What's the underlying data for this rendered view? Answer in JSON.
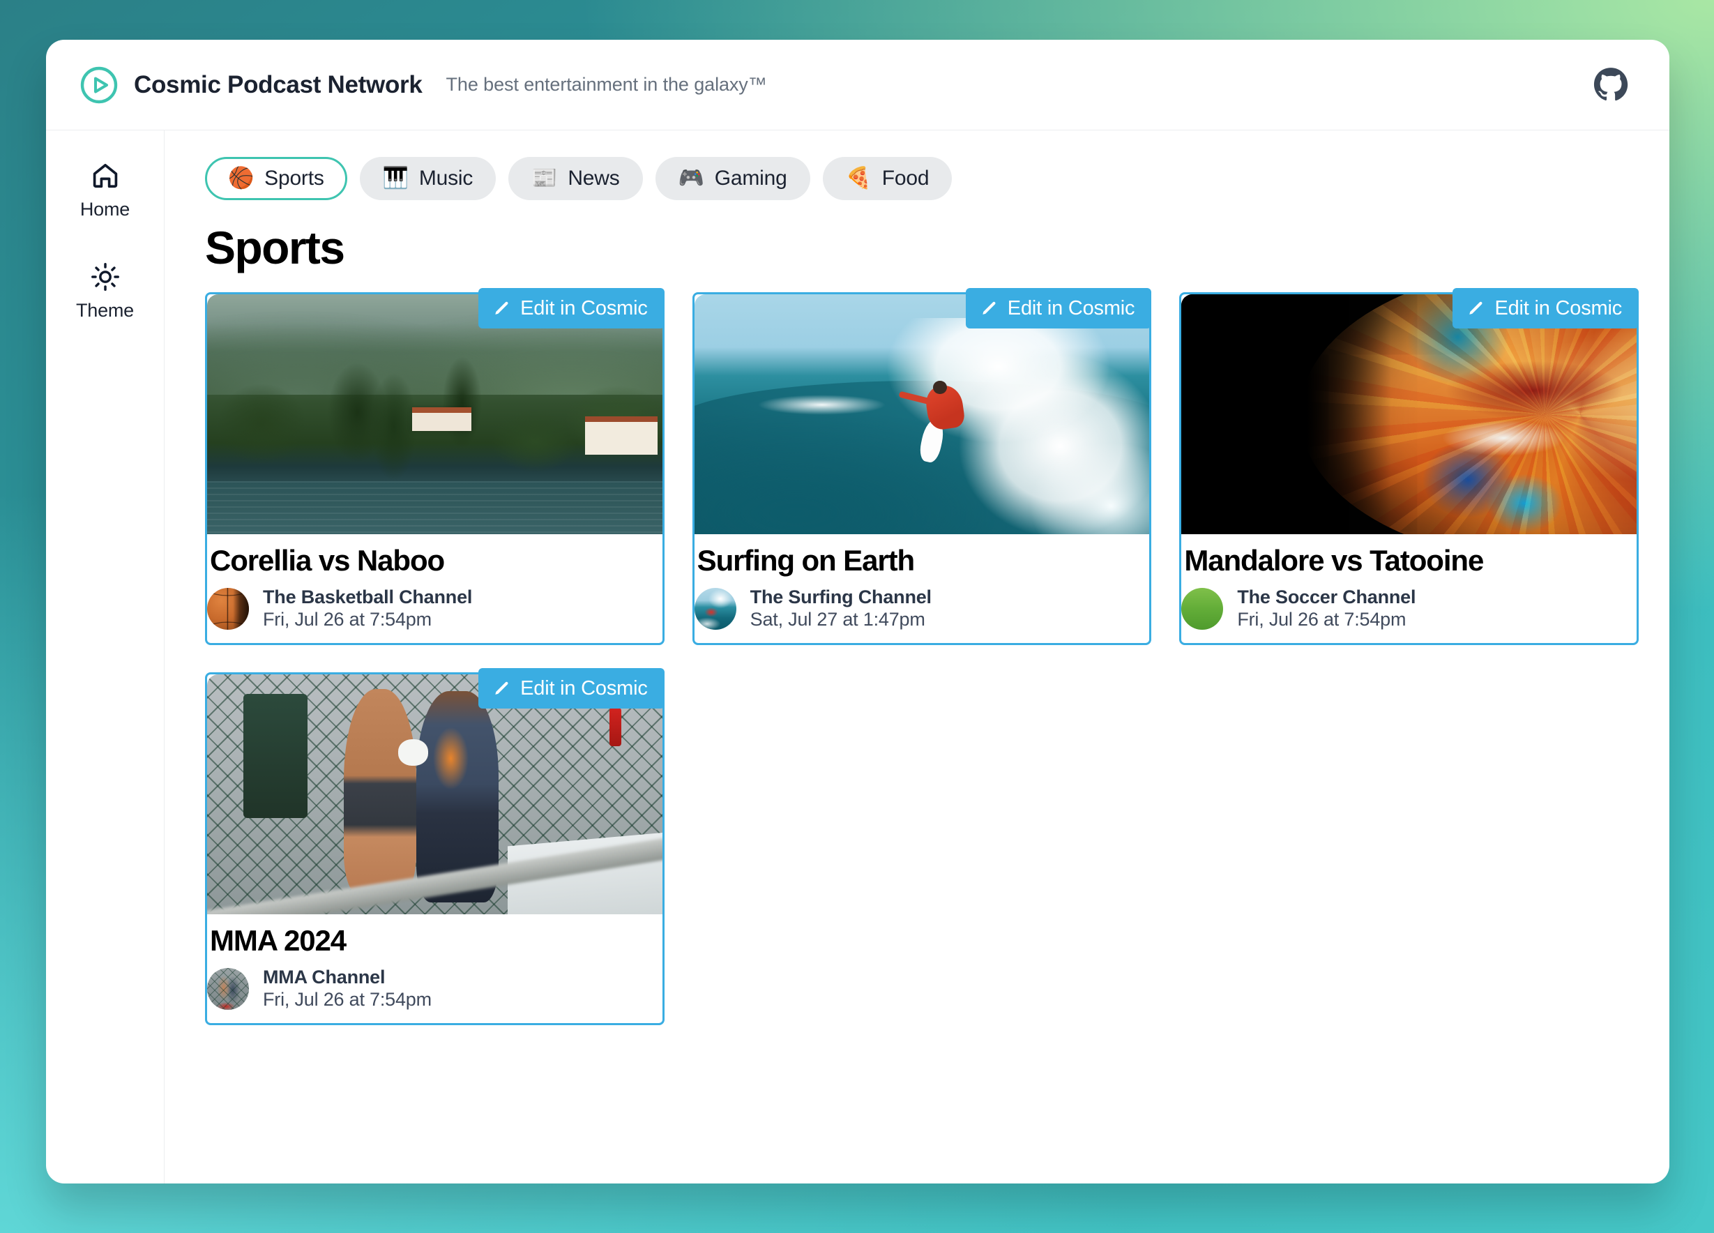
{
  "header": {
    "brand_name": "Cosmic Podcast Network",
    "tagline": "The best entertainment in the galaxy™",
    "logo_icon": "play-circle-icon",
    "github_icon": "github-icon"
  },
  "sidebar": {
    "items": [
      {
        "label": "Home",
        "icon": "home-icon"
      },
      {
        "label": "Theme",
        "icon": "sun-icon"
      }
    ]
  },
  "tabs": [
    {
      "label": "Sports",
      "emoji": "🏀",
      "icon": "basketball-emoji",
      "active": true
    },
    {
      "label": "Music",
      "emoji": "🎹",
      "icon": "piano-emoji",
      "active": false
    },
    {
      "label": "News",
      "emoji": "📰",
      "icon": "newspaper-emoji",
      "active": false
    },
    {
      "label": "Gaming",
      "emoji": "🎮",
      "icon": "gamepad-emoji",
      "active": false
    },
    {
      "label": "Food",
      "emoji": "🍕",
      "icon": "pizza-emoji",
      "active": false
    }
  ],
  "main": {
    "page_title": "Sports",
    "edit_badge_label": "Edit in Cosmic",
    "edit_badge_icon": "pencil-icon",
    "cards": [
      {
        "title": "Corellia vs Naboo",
        "channel": "The Basketball Channel",
        "airdate": "Fri, Jul 26 at 7:54pm",
        "image": "lake-como-hillside-villas",
        "avatar": "basketball-photo"
      },
      {
        "title": "Surfing on Earth",
        "channel": "The Surfing Channel",
        "airdate": "Sat, Jul 27 at 1:47pm",
        "image": "surfer-riding-ocean-wave",
        "avatar": "surfer-photo"
      },
      {
        "title": "Mandalore vs Tatooine",
        "channel": "The Soccer Channel",
        "airdate": "Fri, Jul 26 at 7:54pm",
        "image": "colorful-marble-planet",
        "avatar": "soccer-ball-photo"
      },
      {
        "title": "MMA 2024",
        "channel": "MMA Channel",
        "airdate": "Fri, Jul 26 at 7:54pm",
        "image": "mma-fighters-in-cage",
        "avatar": "mma-fighters-photo"
      }
    ]
  },
  "colors": {
    "accent_teal": "#3ec4b0",
    "edit_badge_blue": "#3aade2",
    "card_border_blue": "#3aade2",
    "text_dark": "#1b2230",
    "text_muted": "#66707d",
    "background_gradient_start": "#2b8087",
    "background_gradient_green": "#a9e7a4",
    "background_gradient_end": "#46c8c8"
  }
}
